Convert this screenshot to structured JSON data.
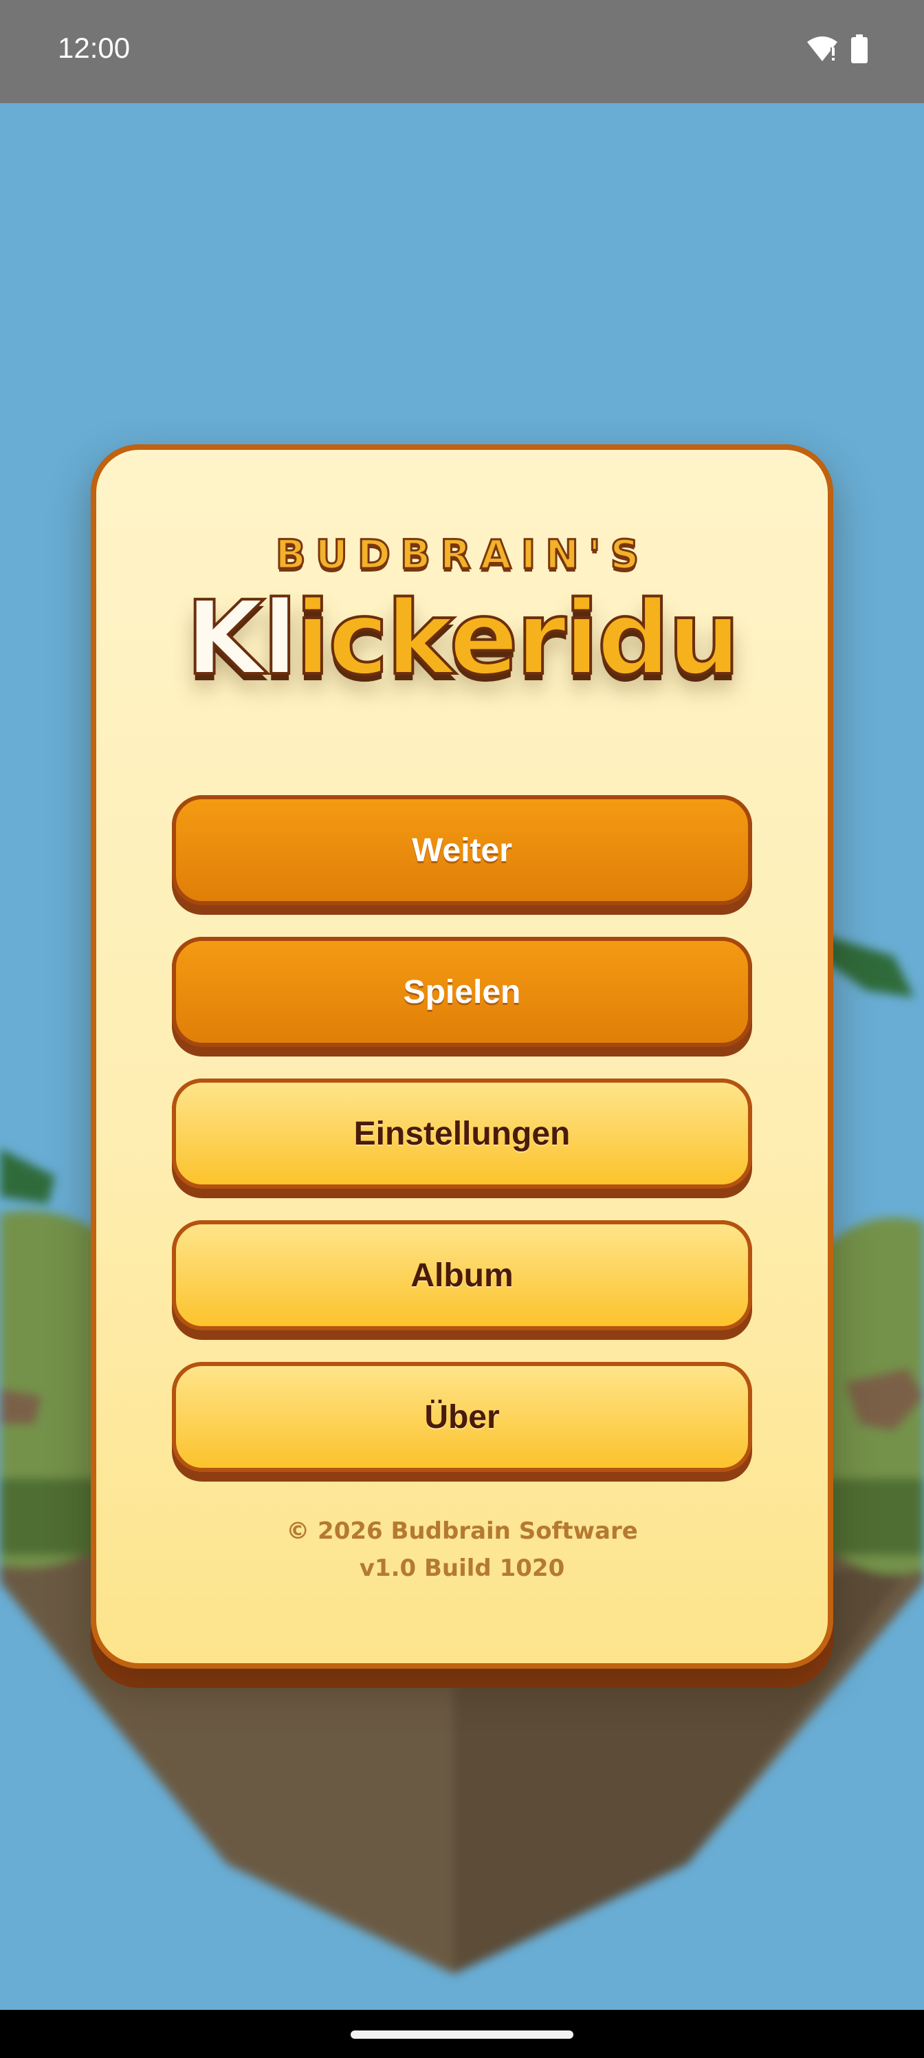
{
  "status_bar": {
    "time": "12:00",
    "icons": [
      "wifi-alert-icon",
      "battery-icon"
    ]
  },
  "card": {
    "brand": "BUDBRAIN'S",
    "logo_part1": "Kl",
    "logo_part2": "ickeridu"
  },
  "menu": {
    "continue_label": "Weiter",
    "play_label": "Spielen",
    "settings_label": "Einstellungen",
    "album_label": "Album",
    "about_label": "Über"
  },
  "footer": {
    "copyright": "© 2026 Budbrain Software",
    "version": "v1.0 Build 1020"
  },
  "colors": {
    "sky": "#69add4",
    "primary_button": "#e8880c",
    "secondary_button": "#fdd35a",
    "card_background": "#fef0b8",
    "card_border": "#c0620f"
  }
}
